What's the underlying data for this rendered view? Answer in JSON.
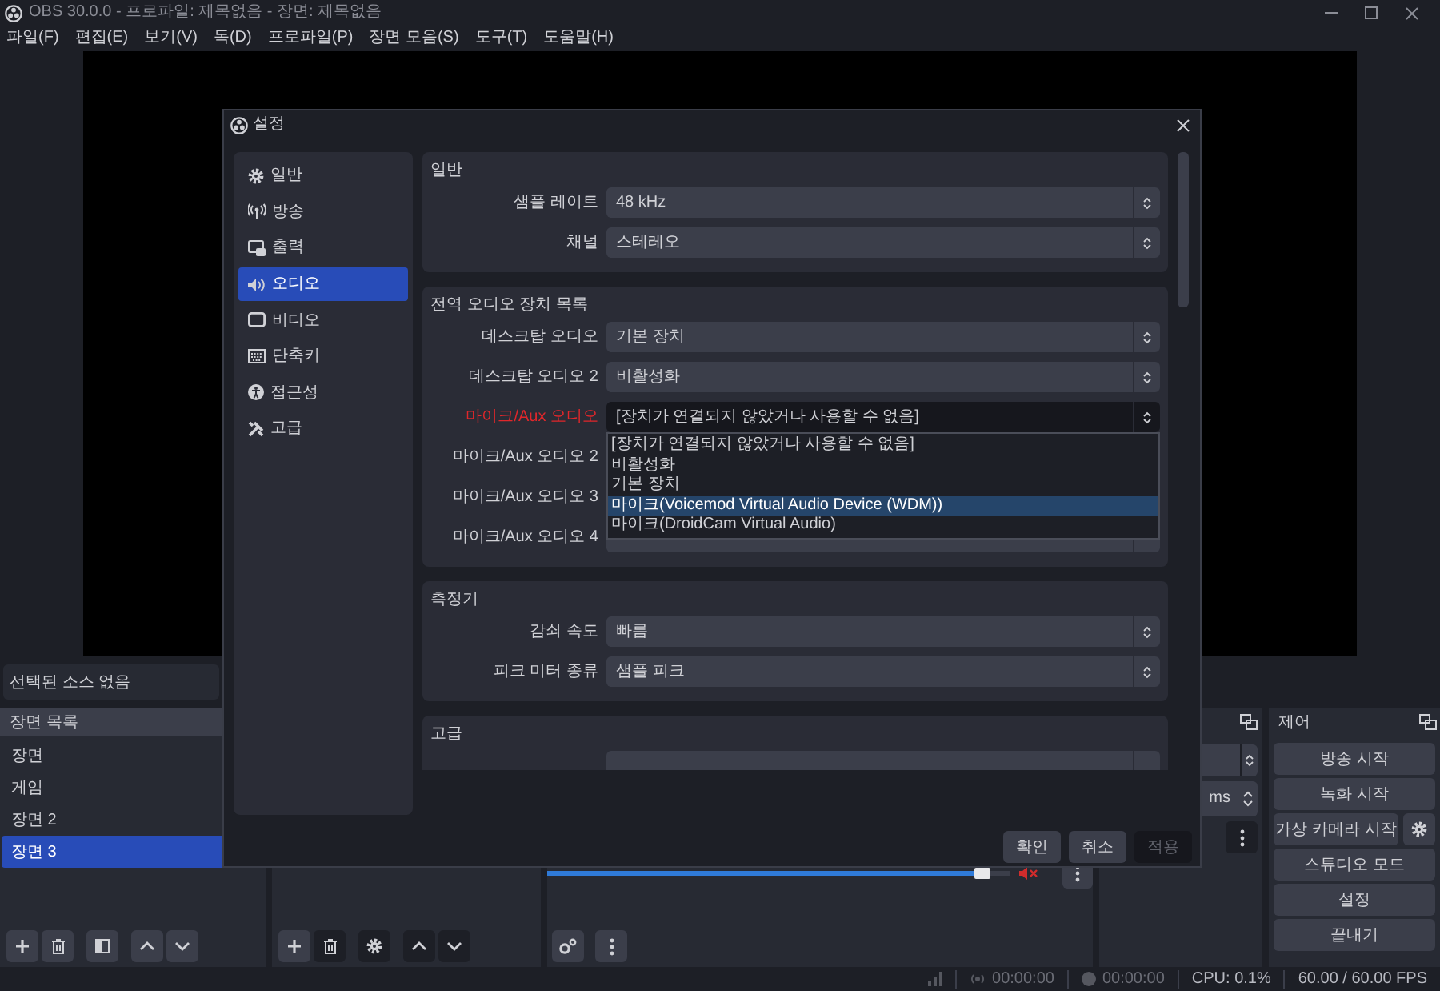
{
  "window": {
    "title": "OBS 30.0.0 - 프로파일: 제목없음 - 장면: 제목없음"
  },
  "menu": [
    "파일(F)",
    "편집(E)",
    "보기(V)",
    "독(D)",
    "프로파일(P)",
    "장면 모음(S)",
    "도구(T)",
    "도움말(H)"
  ],
  "source_toolbar": {
    "text": "선택된 소스 없음"
  },
  "scenes": {
    "title": "장면 목록",
    "items": [
      {
        "label": "장면",
        "selected": false
      },
      {
        "label": "게임",
        "selected": false
      },
      {
        "label": "장면 2",
        "selected": false
      },
      {
        "label": "장면 3",
        "selected": true
      }
    ]
  },
  "mixer": {
    "muted": true,
    "level": 0.96
  },
  "transitions": {
    "duration": "ms"
  },
  "controls": {
    "title": "제어",
    "buttons": [
      {
        "label": "방송 시작",
        "kind": "plain"
      },
      {
        "label": "녹화 시작",
        "kind": "plain"
      },
      {
        "label": "가상 카메라 시작",
        "kind": "with-settings"
      },
      {
        "label": "스튜디오 모드",
        "kind": "plain"
      },
      {
        "label": "설정",
        "kind": "plain"
      },
      {
        "label": "끝내기",
        "kind": "plain"
      }
    ]
  },
  "status_bar": {
    "stream_time": "00:00:00",
    "record_time": "00:00:00",
    "cpu": "CPU: 0.1%",
    "fps": "60.00 / 60.00 FPS"
  },
  "settings": {
    "title": "설정",
    "sidebar": [
      {
        "label": "일반",
        "selected": false
      },
      {
        "label": "방송",
        "selected": false
      },
      {
        "label": "출력",
        "selected": false
      },
      {
        "label": "오디오",
        "selected": true
      },
      {
        "label": "비디오",
        "selected": false
      },
      {
        "label": "단축키",
        "selected": false
      },
      {
        "label": "접근성",
        "selected": false
      },
      {
        "label": "고급",
        "selected": false
      }
    ],
    "groups": [
      {
        "title": "일반",
        "rows": [
          {
            "label": "샘플 레이트",
            "value": "48 kHz",
            "open": false
          },
          {
            "label": "채널",
            "value": "스테레오",
            "open": false
          }
        ]
      },
      {
        "title": "전역 오디오 장치 목록",
        "rows": [
          {
            "label": "데스크탑 오디오",
            "value": "기본 장치",
            "open": false
          },
          {
            "label": "데스크탑 오디오 2",
            "value": "비활성화",
            "open": false
          },
          {
            "label": "마이크/Aux 오디오",
            "value": "[장치가 연결되지 않았거나 사용할 수 없음]",
            "warning": true,
            "open": true
          },
          {
            "label": "마이크/Aux 오디오 2",
            "open": false
          },
          {
            "label": "마이크/Aux 오디오 3",
            "open": false
          },
          {
            "label": "마이크/Aux 오디오 4",
            "open": false
          }
        ]
      },
      {
        "title": "측정기",
        "rows": [
          {
            "label": "감쇠 속도",
            "value": "빠름",
            "open": false
          },
          {
            "label": "피크 미터 종류",
            "value": "샘플 피크",
            "open": false
          }
        ]
      },
      {
        "title": "고급",
        "rows": [
          {
            "open": false
          }
        ]
      }
    ],
    "dropdown": [
      {
        "label": "[장치가 연결되지 않았거나 사용할 수 없음]",
        "selected": false
      },
      {
        "label": "비활성화",
        "selected": false
      },
      {
        "label": "기본 장치",
        "selected": false
      },
      {
        "label": "마이크(Voicemod Virtual Audio Device (WDM))",
        "selected": true
      },
      {
        "label": "마이크(DroidCam Virtual Audio)",
        "selected": false
      }
    ],
    "buttons": [
      {
        "label": "확인",
        "disabled": false
      },
      {
        "label": "취소",
        "disabled": false
      },
      {
        "label": "적용",
        "disabled": true
      }
    ]
  }
}
